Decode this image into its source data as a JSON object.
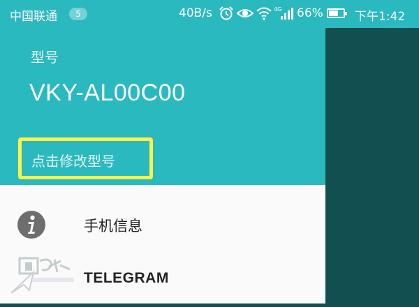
{
  "status_bar": {
    "carrier": "中国联通",
    "notification_count": "5",
    "net_speed": "40B/s",
    "battery_percent": "66%",
    "battery_level": 0.66,
    "time": "下午1:42",
    "icons": [
      "alarm-icon",
      "eye-icon",
      "wifi-icon",
      "signal-4g-icon",
      "battery-icon"
    ]
  },
  "drawer": {
    "header": {
      "caption": "型号",
      "model": "VKY-AL00C00",
      "edit_link": "点击修改型号",
      "highlight_color": "#fff04a"
    },
    "items": [
      {
        "icon": "info-icon",
        "label": "手机信息"
      },
      {
        "icon": "telegram-icon",
        "label": "TELEGRAM"
      }
    ]
  },
  "colors": {
    "accent": "#2ab9bf",
    "scrim": "#124f50"
  }
}
